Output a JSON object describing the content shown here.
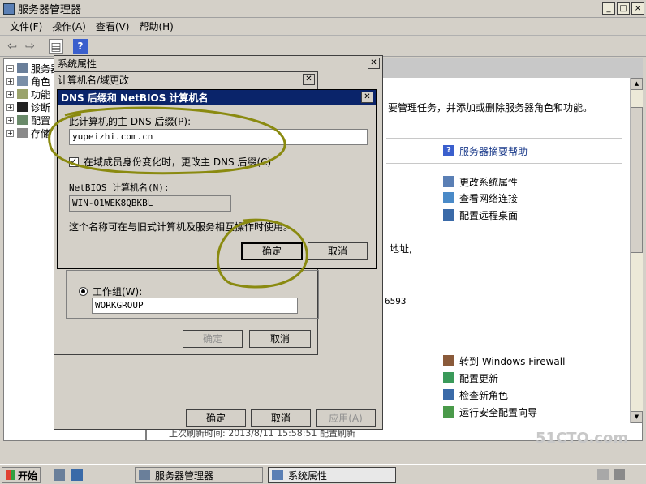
{
  "main_window": {
    "title": "服务器管理器",
    "controls": [
      "_",
      "□",
      "×"
    ]
  },
  "menu": [
    "文件(F)",
    "操作(A)",
    "查看(V)",
    "帮助(H)"
  ],
  "tree": {
    "root": "服务器",
    "items": [
      "角色",
      "功能",
      "诊断",
      "配置",
      "存储"
    ]
  },
  "content": {
    "intro": "要管理任务，并添加或删除服务器角色和功能。",
    "help_link": "服务器摘要帮助",
    "links1": [
      "更改系统属性",
      "查看网络连接",
      "配置远程桌面"
    ],
    "addr_text": "地址,",
    "num_text": "6593",
    "links2": [
      "转到 Windows Firewall",
      "配置更新",
      "检查新角色",
      "运行安全配置向导"
    ],
    "status_snippet": "上次刷新时间: 2013/8/11 15:58:51  配置刷新"
  },
  "sysprops": {
    "title": "系统属性",
    "ok": "确定",
    "cancel": "取消",
    "apply": "应用(A)"
  },
  "compname": {
    "title": "计算机名/域更改",
    "workgroup_label": "工作组(W):",
    "workgroup_value": "WORKGROUP",
    "ok": "确定",
    "cancel": "取消"
  },
  "dns": {
    "title": "DNS 后缀和 NetBIOS 计算机名",
    "suffix_label": "此计算机的主 DNS 后缀(P):",
    "suffix_value": "yupeizhi.com.cn",
    "checkbox_label": "在域成员身份变化时，更改主 DNS 后缀(C)",
    "netbios_label": "NetBIOS 计算机名(N):",
    "netbios_value": "WIN-O1WEK8QBKBL",
    "note": "这个名称可在与旧式计算机及服务相互操作时使用。",
    "ok": "确定",
    "cancel": "取消"
  },
  "taskbar": {
    "start": "开始",
    "tasks": [
      "服务器管理器",
      "系统属性"
    ]
  },
  "watermark": "51CTO.com",
  "colors": {
    "active_title": "#0a246a",
    "annotation": "#8a8a10"
  }
}
